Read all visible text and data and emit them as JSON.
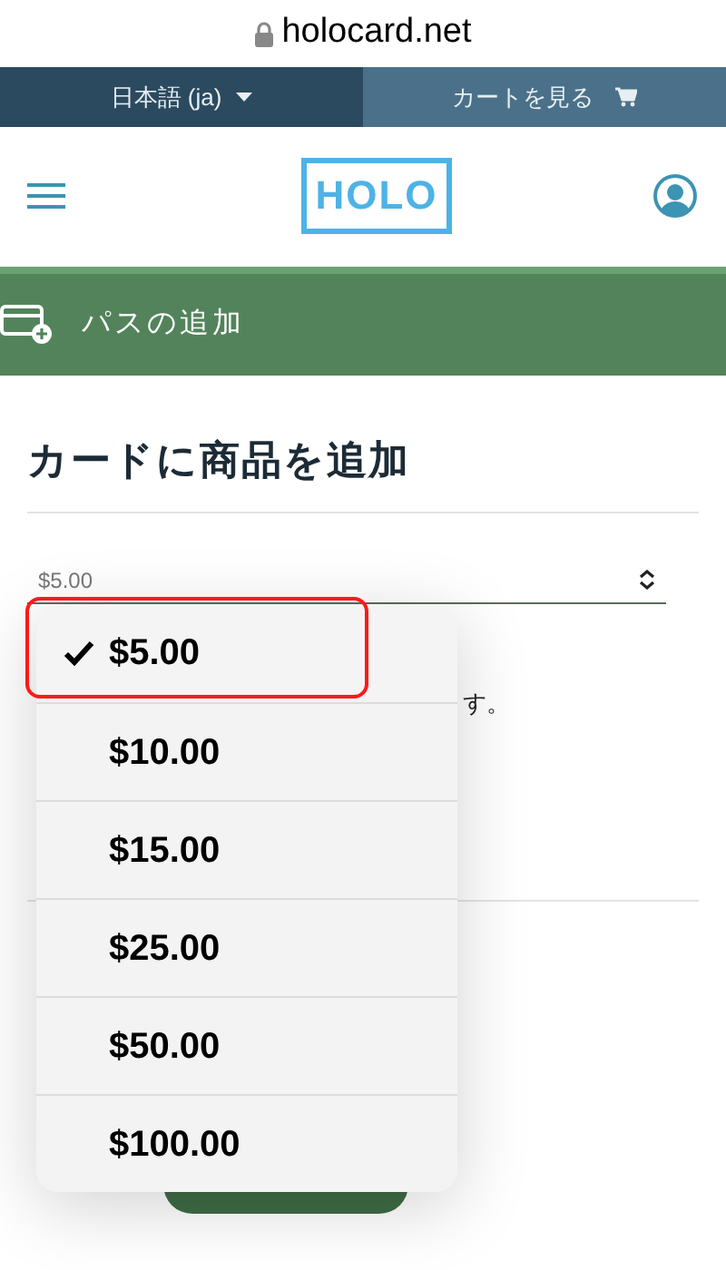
{
  "address_bar": {
    "url": "holocard.net"
  },
  "top_bar": {
    "language": "日本語 (ja)",
    "cart": "カートを見る"
  },
  "header": {
    "logo": "HOLO"
  },
  "banner": {
    "label": "パスの追加"
  },
  "section": {
    "title": "カードに商品を追加",
    "select": {
      "value": "$5.00"
    },
    "text_fragment": "す。"
  },
  "dropdown": {
    "options": [
      {
        "label": "$5.00",
        "selected": true
      },
      {
        "label": "$10.00",
        "selected": false
      },
      {
        "label": "$15.00",
        "selected": false
      },
      {
        "label": "$25.00",
        "selected": false
      },
      {
        "label": "$50.00",
        "selected": false
      },
      {
        "label": "$100.00",
        "selected": false
      }
    ]
  }
}
